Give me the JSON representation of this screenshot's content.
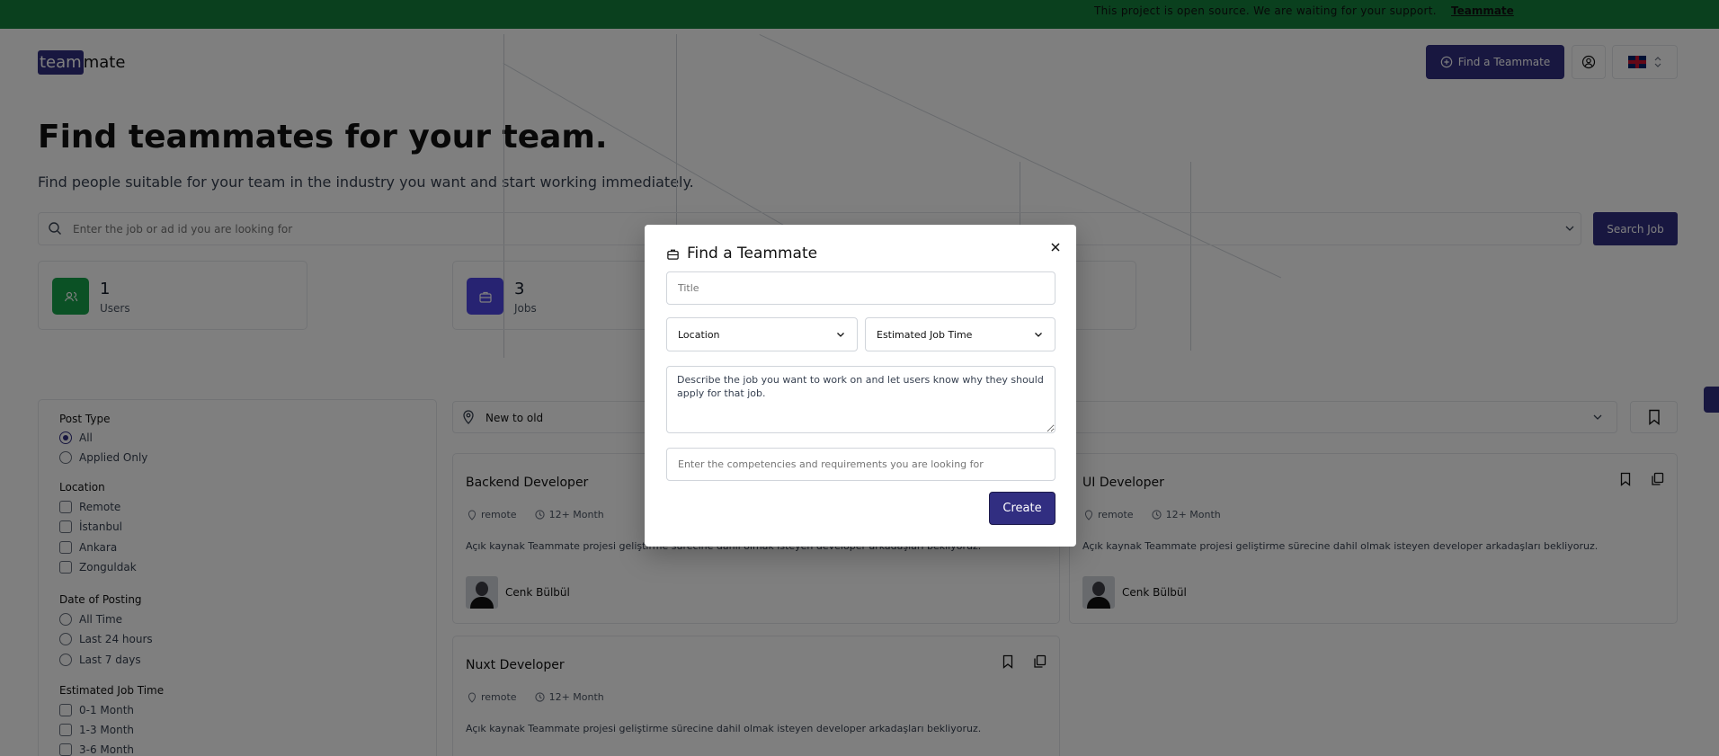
{
  "banner": {
    "message": "This project is open source. We are waiting for your support.",
    "link": "Teammate"
  },
  "header": {
    "logo_highlight": "team",
    "logo_rest": "mate",
    "find_button": "Find a Teammate"
  },
  "hero": {
    "title": "Find teammates for your team.",
    "subtitle": "Find people suitable for your team in the industry you want and start working immediately."
  },
  "search": {
    "placeholder": "Enter the job or ad id you are looking for",
    "button": "Search Job"
  },
  "stats": [
    {
      "value": "1",
      "label": "Users",
      "color": "#16a34a"
    },
    {
      "value": "3",
      "label": "Jobs",
      "color": "#4f46e5"
    }
  ],
  "filters": {
    "post_type": {
      "title": "Post Type",
      "options": [
        "All",
        "Applied Only"
      ],
      "selected": "All"
    },
    "location": {
      "title": "Location",
      "options": [
        "Remote",
        "İstanbul",
        "Ankara",
        "Zonguldak"
      ]
    },
    "date_of_posting": {
      "title": "Date of Posting",
      "options": [
        "All Time",
        "Last 24 hours",
        "Last 7 days"
      ]
    },
    "estimated_job_time": {
      "title": "Estimated Job Time",
      "options": [
        "0-1 Month",
        "1-3 Month",
        "3-6 Month"
      ]
    }
  },
  "sort": {
    "value": "New to old"
  },
  "jobs": [
    {
      "title": "Backend Developer",
      "location": "remote",
      "duration": "12+ Month",
      "description": "Açık kaynak Teammate projesi geliştirme sürecine dahil olmak isteyen developer arkadaşları bekliyoruz.",
      "author": "Cenk Bülbül"
    },
    {
      "title": "UI Developer",
      "location": "remote",
      "duration": "12+ Month",
      "description": "Açık kaynak Teammate projesi geliştirme sürecine dahil olmak isteyen developer arkadaşları bekliyoruz.",
      "author": "Cenk Bülbül"
    },
    {
      "title": "Nuxt Developer",
      "location": "remote",
      "duration": "12+ Month",
      "description": "Açık kaynak Teammate projesi geliştirme sürecine dahil olmak isteyen developer arkadaşları bekliyoruz.",
      "author": ""
    }
  ],
  "modal": {
    "title": "Find a Teammate",
    "title_placeholder": "Title",
    "location_select": "Location",
    "job_time_select": "Estimated Job Time",
    "description_value": "Describe the job you want to work on and let users know why they should apply for that job.",
    "competencies_placeholder": "Enter the competencies and requirements you are looking for",
    "create_button": "Create"
  },
  "colors": {
    "accent": "#312e81",
    "banner": "#15803d",
    "overlay": "rgba(0,0,0,0.5)"
  }
}
